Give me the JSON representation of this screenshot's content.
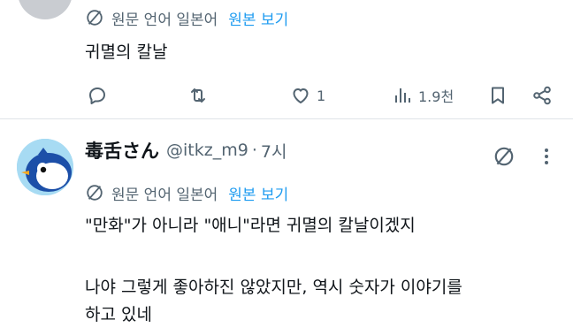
{
  "post1": {
    "translate": {
      "icon": "translate-icon",
      "language_text": "원문 언어 일본어",
      "view_original_label": "원본 보기"
    },
    "text": "귀멸의 칼날",
    "actions": {
      "reply": {
        "icon": "reply-icon"
      },
      "repost": {
        "icon": "repost-icon"
      },
      "like": {
        "icon": "like-icon",
        "count": "1"
      },
      "views": {
        "icon": "analytics-icon",
        "count": "1.9천"
      },
      "bookmark": {
        "icon": "bookmark-icon"
      },
      "share": {
        "icon": "share-icon"
      }
    }
  },
  "post2": {
    "author": {
      "display_name": "毒舌さん",
      "handle": "@itkz_m9",
      "separator": "·",
      "time": "7시"
    },
    "header_icons": [
      "translate-icon",
      "more-icon"
    ],
    "translate": {
      "icon": "translate-icon",
      "language_text": "원문 언어 일본어",
      "view_original_label": "원본 보기"
    },
    "text_line1": "\"만화\"가 아니라 \"애니\"라면 귀멸의 칼날이겠지",
    "text_line2": "나야 그렇게 좋아하진 않았지만, 역시 숫자가 이야기를",
    "text_line3": "하고 있네"
  },
  "colors": {
    "text": "#0f1419",
    "secondary": "#536471",
    "link": "#1d9bf0",
    "divider": "#dfe3e8"
  }
}
